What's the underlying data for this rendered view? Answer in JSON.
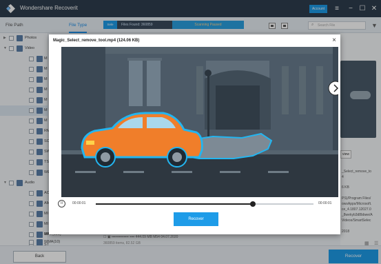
{
  "app": {
    "title": "Wondershare Recoverit",
    "account_label": "Account"
  },
  "window_controls": [
    "≡",
    "−",
    "☐",
    "✕"
  ],
  "tabs": [
    {
      "label": "File Path",
      "active": false
    },
    {
      "label": "File Type",
      "active": true
    }
  ],
  "status": {
    "tag": "Sele",
    "files_found": "Files Found: 360859",
    "progress_label": "Scanning Paused"
  },
  "search": {
    "placeholder": "Search File"
  },
  "tree": [
    {
      "label": "Photos",
      "level": 0,
      "expanded": false
    },
    {
      "label": "Video",
      "level": 0,
      "expanded": true
    },
    {
      "label": "M",
      "level": 1
    },
    {
      "label": "M",
      "level": 1
    },
    {
      "label": "M",
      "level": 1
    },
    {
      "label": "M",
      "level": 1
    },
    {
      "label": "M",
      "level": 1
    },
    {
      "label": "M",
      "level": 1,
      "selected": true
    },
    {
      "label": "M",
      "level": 1
    },
    {
      "label": "RM",
      "level": 1
    },
    {
      "label": "SC",
      "level": 1
    },
    {
      "label": "SW",
      "level": 1
    },
    {
      "label": "TS",
      "level": 1
    },
    {
      "label": "WE",
      "level": 1
    },
    {
      "label": "Audio",
      "level": 0,
      "expanded": true
    },
    {
      "label": "AC",
      "level": 1
    },
    {
      "label": "AM",
      "level": 1
    },
    {
      "label": "MI",
      "level": 1
    },
    {
      "label": "MI",
      "level": 1
    },
    {
      "label": "MF",
      "level": 1
    },
    {
      "label": "ST",
      "level": 1
    },
    {
      "label": "WAV(228)",
      "level": 1
    },
    {
      "label": "WMA(10)",
      "level": 1
    }
  ],
  "right_panel": {
    "view_label": "view",
    "name_lines": [
      "_Select_remove_to",
      "4"
    ],
    "size": "6 KB",
    "path_lines": [
      "PS)/Program Files/",
      "owsApps/Microsoft.",
      "ce_4.1807.12027.0",
      "_8wekyb3d8bbwe/A",
      "Videos/SmartSelec"
    ],
    "date": "2018"
  },
  "list_bottom": {
    "row": "☐  ▣  ▪▪▪▪▪▪▪▪▪▪▪▪▪▪ ▪▪▪▪          444.09 MB          M54          04.07.2020",
    "count": "360859 items, 82.52 GB"
  },
  "footer": {
    "back_label": "Back",
    "recover_label": "Recover"
  },
  "preview": {
    "title": "Magic_Select_remove_tool.mp4 (124.06 KB)",
    "close": "×",
    "pause_icon": "II",
    "time_current": "00:00:01",
    "time_end": "00:00:01",
    "progress": 0.72,
    "recover_label": "Recover"
  }
}
